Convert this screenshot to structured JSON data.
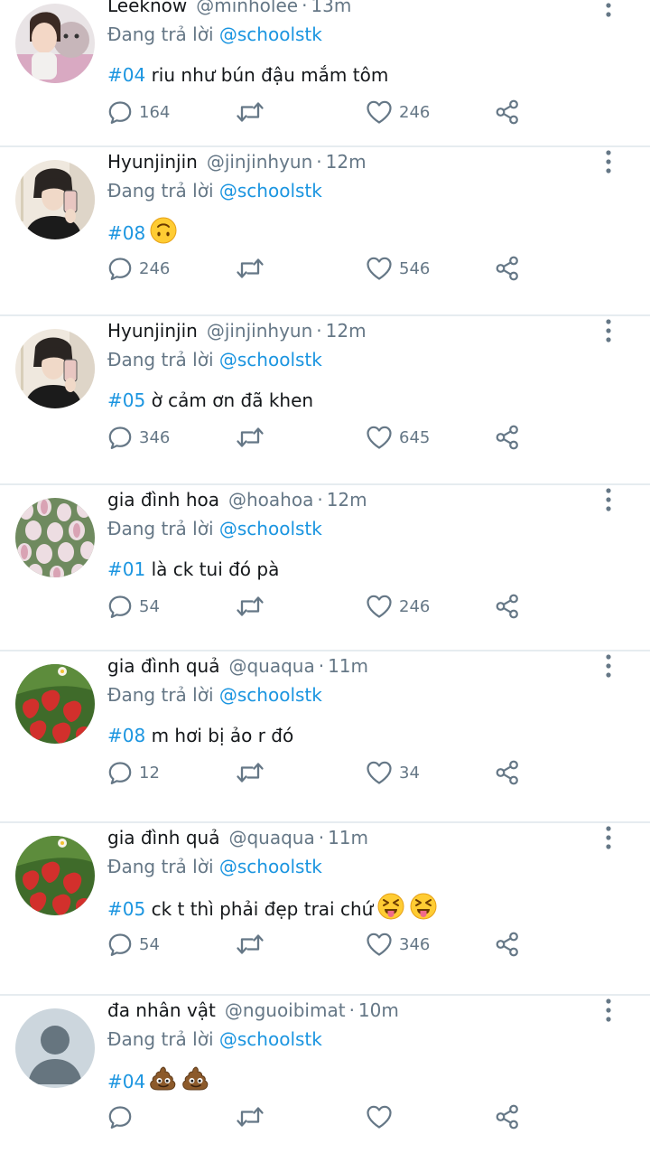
{
  "tweets": [
    {
      "name": "Leeknow",
      "handle": "@minholee",
      "time": "13m",
      "replying_prefix": "Đang trả lời",
      "replying_to": "@schoolstk",
      "tag": "#04",
      "text": "riu như bún đậu mắm tôm",
      "emojis": [],
      "reply_count": "164",
      "retweet_count": "",
      "like_count": "246",
      "avatar": "girl-with-stuffed-toy"
    },
    {
      "name": "Hyunjinjin",
      "handle": "@jinjinhyun",
      "time": "12m",
      "replying_prefix": "Đang trả lời",
      "replying_to": "@schoolstk",
      "tag": "#08",
      "text": "",
      "emojis": [
        "upside-down-face"
      ],
      "reply_count": "246",
      "retweet_count": "",
      "like_count": "546",
      "avatar": "mirror-selfie"
    },
    {
      "name": "Hyunjinjin",
      "handle": "@jinjinhyun",
      "time": "12m",
      "replying_prefix": "Đang trả lời",
      "replying_to": "@schoolstk",
      "tag": "#05",
      "text": "ờ cảm ơn đã khen",
      "emojis": [],
      "reply_count": "346",
      "retweet_count": "",
      "like_count": "645",
      "avatar": "mirror-selfie"
    },
    {
      "name": "gia đình hoa",
      "handle": "@hoahoa",
      "time": "12m",
      "replying_prefix": "Đang trả lời",
      "replying_to": "@schoolstk",
      "tag": "#01",
      "text": "là ck tui đó pà",
      "emojis": [],
      "reply_count": "54",
      "retweet_count": "",
      "like_count": "246",
      "avatar": "tulips"
    },
    {
      "name": "gia đình quả",
      "handle": "@quaqua",
      "time": "11m",
      "replying_prefix": "Đang trả lời",
      "replying_to": "@schoolstk",
      "tag": "#08",
      "text": "m hơi bị ảo r đó",
      "emojis": [],
      "reply_count": "12",
      "retweet_count": "",
      "like_count": "34",
      "avatar": "strawberries"
    },
    {
      "name": "gia đình quả",
      "handle": "@quaqua",
      "time": "11m",
      "replying_prefix": "Đang trả lời",
      "replying_to": "@schoolstk",
      "tag": "#05",
      "text": "ck t thì phải đẹp trai chứ",
      "emojis": [
        "squinting-tongue-face",
        "squinting-tongue-face"
      ],
      "reply_count": "54",
      "retweet_count": "",
      "like_count": "346",
      "avatar": "strawberries"
    },
    {
      "name": "đa nhân vật",
      "handle": "@nguoibimat",
      "time": "10m",
      "replying_prefix": "Đang trả lời",
      "replying_to": "@schoolstk",
      "tag": "#04",
      "text": "",
      "emojis": [
        "pile-of-poo",
        "pile-of-poo"
      ],
      "reply_count": "",
      "retweet_count": "",
      "like_count": "",
      "avatar": "default-silhouette"
    }
  ],
  "colors": {
    "link": "#1b95e0",
    "muted": "#657786",
    "divider": "#e6ecf0",
    "text": "#14171a"
  },
  "icons": {
    "reply": "speech-bubble-icon",
    "retweet": "retweet-icon",
    "like": "heart-icon",
    "share": "share-icon",
    "more": "vertical-dots-icon"
  }
}
